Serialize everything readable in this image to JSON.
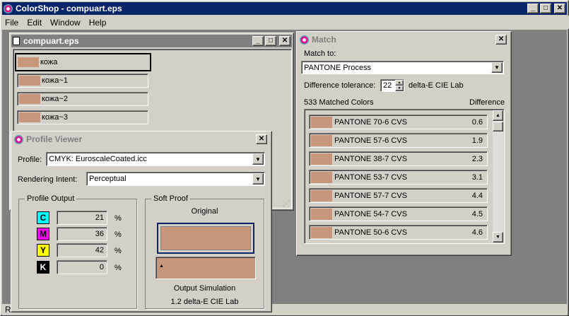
{
  "app": {
    "title": "ColorShop - compuart.eps"
  },
  "menu": [
    "File",
    "Edit",
    "Window",
    "Help"
  ],
  "document": {
    "title": "compuart.eps",
    "swatches": [
      "кожа",
      "кожа~1",
      "кожа~2",
      "кожа~3"
    ]
  },
  "profile_viewer": {
    "title": "Profile Viewer",
    "profile_label": "Profile:",
    "profile_value": "CMYK: EuroscaleCoated.icc",
    "intent_label": "Rendering Intent:",
    "intent_value": "Perceptual",
    "output_group": "Profile Output",
    "channels": [
      {
        "letter": "C",
        "value": "21",
        "unit": "%",
        "color": "#00ffff"
      },
      {
        "letter": "M",
        "value": "36",
        "unit": "%",
        "color": "#ff00ff"
      },
      {
        "letter": "Y",
        "value": "42",
        "unit": "%",
        "color": "#ffff00"
      },
      {
        "letter": "K",
        "value": "0",
        "unit": "%",
        "color": "#000000"
      }
    ],
    "soft_proof_group": "Soft Proof",
    "original_label": "Original",
    "output_sim_label": "Output Simulation",
    "delta_label": "1.2 delta-E CIE Lab"
  },
  "match": {
    "title": "Match",
    "match_to_label": "Match to:",
    "match_to_value": "PANTONE Process",
    "tolerance_label": "Difference tolerance:",
    "tolerance_value": "22",
    "tolerance_unit": "delta-E CIE Lab",
    "matched_count": "533 Matched Colors",
    "difference_header": "Difference",
    "rows": [
      {
        "name": "PANTONE 70-6 CVS",
        "diff": "0.6"
      },
      {
        "name": "PANTONE 57-6 CVS",
        "diff": "1.9"
      },
      {
        "name": "PANTONE 38-7 CVS",
        "diff": "2.3"
      },
      {
        "name": "PANTONE 53-7 CVS",
        "diff": "3.1"
      },
      {
        "name": "PANTONE 57-7 CVS",
        "diff": "4.4"
      },
      {
        "name": "PANTONE 54-7 CVS",
        "diff": "4.5"
      },
      {
        "name": "PANTONE 50-6 CVS",
        "diff": "4.6"
      }
    ]
  },
  "status": {
    "text": "R"
  },
  "colors": {
    "swatch": "#c8967a",
    "title_active": "#0a246a",
    "workspace": "#c0c0c0"
  }
}
